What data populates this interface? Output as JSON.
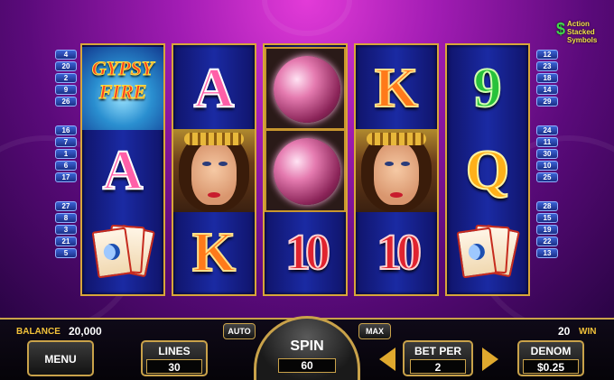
{
  "game": {
    "logo_text": "GYPSY",
    "logo_subtext": "FIRE",
    "corner_logo": "Action Stacked Symbols",
    "corner_logo_mark": "$"
  },
  "paylines": {
    "left": [
      "4",
      "20",
      "2",
      "9",
      "26",
      "16",
      "7",
      "1",
      "6",
      "17",
      "27",
      "8",
      "3",
      "21",
      "5"
    ],
    "right": [
      "12",
      "23",
      "18",
      "14",
      "29",
      "24",
      "11",
      "30",
      "10",
      "25",
      "28",
      "15",
      "19",
      "22",
      "13"
    ]
  },
  "reels": [
    [
      {
        "type": "logo"
      },
      {
        "type": "letter",
        "value": "A",
        "cls": "sym-a"
      },
      {
        "type": "cards"
      }
    ],
    [
      {
        "type": "letter",
        "value": "A",
        "cls": "sym-a"
      },
      {
        "type": "face"
      },
      {
        "type": "letter",
        "value": "K",
        "cls": "sym-k"
      }
    ],
    [
      {
        "type": "orb"
      },
      {
        "type": "orb"
      },
      {
        "type": "letter",
        "value": "10",
        "cls": "sym-10"
      }
    ],
    [
      {
        "type": "letter",
        "value": "K",
        "cls": "sym-k"
      },
      {
        "type": "face"
      },
      {
        "type": "letter",
        "value": "10",
        "cls": "sym-10"
      }
    ],
    [
      {
        "type": "letter",
        "value": "9",
        "cls": "sym-9"
      },
      {
        "type": "letter",
        "value": "Q",
        "cls": "sym-q"
      },
      {
        "type": "cards"
      }
    ]
  ],
  "panel": {
    "balance_label": "BALANCE",
    "balance_value": "20,000",
    "win_value": "20",
    "win_label": "WIN",
    "menu_label": "MENU",
    "lines_label": "LINES",
    "lines_value": "30",
    "auto_label": "AUTO",
    "spin_label": "SPIN",
    "spin_value": "60",
    "max_label": "MAX",
    "betper_label": "BET PER",
    "betper_value": "2",
    "denom_label": "DENOM",
    "denom_value": "$0.25"
  },
  "colors": {
    "gold": "#c9a24a",
    "reel_bg": "#1a2aa3",
    "label_yellow": "#f2c23a"
  }
}
